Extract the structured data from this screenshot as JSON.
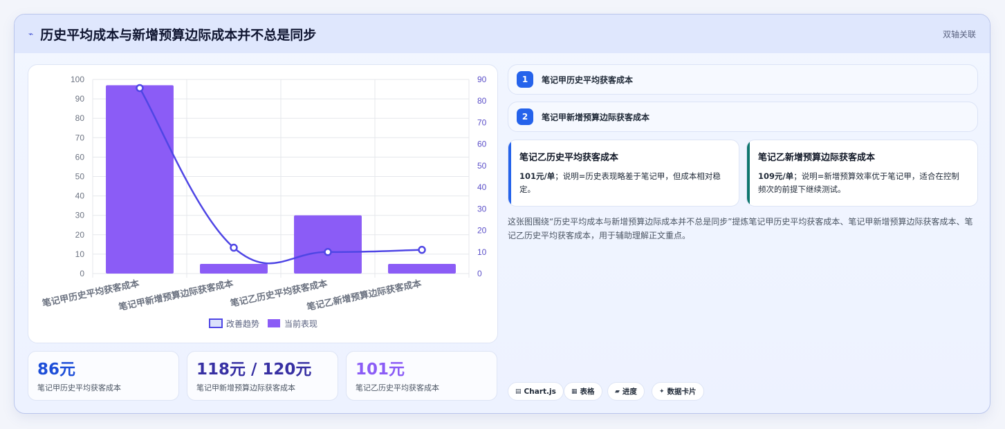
{
  "header": {
    "icon": "chart-trend-icon",
    "icon_glyph": "⌁",
    "title": "历史平均成本与新增预算边际成本并不总是同步",
    "badge": "双轴关联"
  },
  "chart_data": {
    "type": "bar",
    "categories": [
      "笔记甲历史平均获客成本",
      "笔记甲新增预算边际获客成本",
      "笔记乙历史平均获客成本",
      "笔记乙新增预算边际获客成本"
    ],
    "series": [
      {
        "name": "当前表现",
        "type": "bar",
        "axis": "left",
        "color": "#8b5cf6",
        "values": [
          97,
          5,
          30,
          5
        ]
      },
      {
        "name": "改善趋势",
        "type": "line",
        "axis": "right",
        "color": "#4f46e5",
        "smooth": true,
        "values": [
          86,
          12,
          10,
          11
        ]
      }
    ],
    "y_left": {
      "min": 0,
      "max": 100,
      "ticks": [
        0,
        10,
        20,
        30,
        40,
        50,
        60,
        70,
        80,
        90,
        100
      ]
    },
    "y_right": {
      "min": 0,
      "max": 90,
      "ticks": [
        0,
        10,
        20,
        30,
        40,
        50,
        60,
        70,
        80,
        90
      ]
    },
    "grid": true,
    "legend": "bottom-center",
    "title": "",
    "xlabel": "",
    "ylabel": ""
  },
  "kpis": [
    {
      "value": "86元",
      "label": "笔记甲历史平均获客成本",
      "color": "#1d4ed8"
    },
    {
      "value": "118元 / 120元",
      "label": "笔记甲新增预算边际获客成本",
      "color": "#3730a3"
    },
    {
      "value": "101元",
      "label": "笔记乙历史平均获客成本",
      "color": "#8b5cf6"
    }
  ],
  "steps": [
    {
      "num": "1",
      "label": "笔记甲历史平均获客成本"
    },
    {
      "num": "2",
      "label": "笔记甲新增预算边际获客成本"
    }
  ],
  "notes": [
    {
      "title": "笔记乙历史平均获客成本",
      "value": "101元/单",
      "body": "；说明=历史表现略差于笔记甲，但成本相对稳定。",
      "accent": "#2563eb"
    },
    {
      "title": "笔记乙新增预算边际获客成本",
      "value": "109元/单",
      "body": "；说明=新增预算效率优于笔记甲，适合在控制频次的前提下继续测试。",
      "accent": "#0f766e"
    }
  ],
  "summary": "这张图围绕“历史平均成本与新增预算边际成本并不总是同步”提炼笔记甲历史平均获客成本、笔记甲新增预算边际获客成本、笔记乙历史平均获客成本，用于辅助理解正文重点。",
  "tags": [
    {
      "icon": "chart-icon",
      "glyph": "▤",
      "label": "Chart.js"
    },
    {
      "icon": "table-icon",
      "glyph": "▦",
      "label": "表格"
    },
    {
      "icon": "progress-icon",
      "glyph": "▰",
      "label": "进度"
    },
    {
      "icon": "sparkle-icon",
      "glyph": "✦",
      "label": "数据卡片"
    }
  ]
}
